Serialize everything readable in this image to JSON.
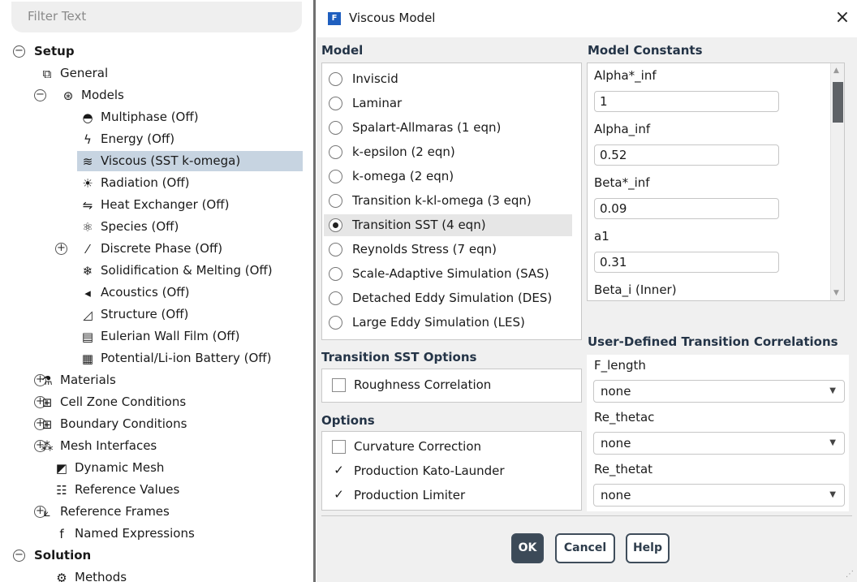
{
  "tree": {
    "filter_placeholder": "Filter Text",
    "nodes": [
      {
        "label": "Setup",
        "bold": true,
        "expander": "−",
        "icon": "",
        "icon_name": ""
      },
      {
        "label": "General",
        "expander": "",
        "icon": "⧉",
        "icon_name": "general-icon"
      },
      {
        "label": "Models",
        "expander": "−",
        "icon": "⊛",
        "icon_name": "models-icon"
      },
      {
        "label": "Multiphase (Off)",
        "expander": "",
        "icon": "◓",
        "icon_name": "multiphase-icon"
      },
      {
        "label": "Energy (Off)",
        "expander": "",
        "icon": "ϟ",
        "icon_name": "energy-icon"
      },
      {
        "label": "Viscous (SST k-omega)",
        "expander": "",
        "icon": "≋",
        "icon_name": "viscous-icon",
        "selected": true
      },
      {
        "label": "Radiation (Off)",
        "expander": "",
        "icon": "☀",
        "icon_name": "radiation-icon"
      },
      {
        "label": "Heat Exchanger (Off)",
        "expander": "",
        "icon": "⇋",
        "icon_name": "heat-exchanger-icon"
      },
      {
        "label": "Species (Off)",
        "expander": "",
        "icon": "⚛",
        "icon_name": "species-icon"
      },
      {
        "label": "Discrete Phase (Off)",
        "expander": "+",
        "icon": "⁄",
        "icon_name": "discrete-phase-icon"
      },
      {
        "label": "Solidification & Melting (Off)",
        "expander": "",
        "icon": "❄",
        "icon_name": "solidification-icon"
      },
      {
        "label": "Acoustics (Off)",
        "expander": "",
        "icon": "◂",
        "icon_name": "acoustics-icon"
      },
      {
        "label": "Structure (Off)",
        "expander": "",
        "icon": "◿",
        "icon_name": "structure-icon"
      },
      {
        "label": "Eulerian Wall Film (Off)",
        "expander": "",
        "icon": "▤",
        "icon_name": "wall-film-icon"
      },
      {
        "label": "Potential/Li-ion Battery (Off)",
        "expander": "",
        "icon": "▦",
        "icon_name": "battery-icon"
      },
      {
        "label": "Materials",
        "expander": "+",
        "icon": "⚗",
        "icon_name": "materials-icon"
      },
      {
        "label": "Cell Zone Conditions",
        "expander": "+",
        "icon": "⊞",
        "icon_name": "cell-zone-icon"
      },
      {
        "label": "Boundary Conditions",
        "expander": "+",
        "icon": "⊞",
        "icon_name": "boundary-conditions-icon"
      },
      {
        "label": "Mesh Interfaces",
        "expander": "+",
        "icon": "⁂",
        "icon_name": "mesh-interfaces-icon"
      },
      {
        "label": "Dynamic Mesh",
        "expander": "",
        "icon": "◩",
        "icon_name": "dynamic-mesh-icon"
      },
      {
        "label": "Reference Values",
        "expander": "",
        "icon": "☷",
        "icon_name": "reference-values-icon"
      },
      {
        "label": "Reference Frames",
        "expander": "+",
        "icon": "⟀",
        "icon_name": "reference-frames-icon"
      },
      {
        "label": "Named Expressions",
        "expander": "",
        "icon": "f",
        "icon_name": "named-expressions-icon"
      },
      {
        "label": "Solution",
        "bold": true,
        "expander": "−",
        "icon": "",
        "icon_name": ""
      },
      {
        "label": "Methods",
        "expander": "",
        "icon": "⚙",
        "icon_name": "methods-icon"
      }
    ]
  },
  "dialog": {
    "logo": "F",
    "title": "Viscous Model",
    "close_glyph": "×",
    "model": {
      "heading": "Model",
      "options": [
        {
          "label": "Inviscid",
          "selected": false
        },
        {
          "label": "Laminar",
          "selected": false
        },
        {
          "label": "Spalart-Allmaras (1 eqn)",
          "selected": false
        },
        {
          "label": "k-epsilon (2 eqn)",
          "selected": false
        },
        {
          "label": "k-omega (2 eqn)",
          "selected": false
        },
        {
          "label": "Transition k-kl-omega (3 eqn)",
          "selected": false
        },
        {
          "label": "Transition SST (4 eqn)",
          "selected": true
        },
        {
          "label": "Reynolds Stress (7 eqn)",
          "selected": false
        },
        {
          "label": "Scale-Adaptive Simulation (SAS)",
          "selected": false
        },
        {
          "label": "Detached Eddy Simulation (DES)",
          "selected": false
        },
        {
          "label": "Large Eddy Simulation (LES)",
          "selected": false
        }
      ]
    },
    "transition_sst_options": {
      "heading": "Transition SST Options",
      "checks": [
        {
          "label": "Roughness Correlation",
          "checked": false
        }
      ]
    },
    "options": {
      "heading": "Options",
      "checks": [
        {
          "label": "Curvature Correction",
          "checked": false
        },
        {
          "label": "Production Kato-Launder",
          "checked": true
        },
        {
          "label": "Production Limiter",
          "checked": true
        }
      ]
    },
    "model_constants": {
      "heading": "Model Constants",
      "items": [
        {
          "label": "Alpha*_inf",
          "value": "1"
        },
        {
          "label": "Alpha_inf",
          "value": "0.52"
        },
        {
          "label": "Beta*_inf",
          "value": "0.09"
        },
        {
          "label": "a1",
          "value": "0.31"
        },
        {
          "label": "Beta_i (Inner)",
          "value": ""
        }
      ]
    },
    "correlations": {
      "heading": "User-Defined Transition Correlations",
      "items": [
        {
          "label": "F_length",
          "value": "none"
        },
        {
          "label": "Re_thetac",
          "value": "none"
        },
        {
          "label": "Re_thetat",
          "value": "none"
        }
      ]
    },
    "buttons": {
      "ok": "OK",
      "cancel": "Cancel",
      "help": "Help"
    },
    "check_glyph": "✓",
    "caret_glyph": "▼"
  }
}
